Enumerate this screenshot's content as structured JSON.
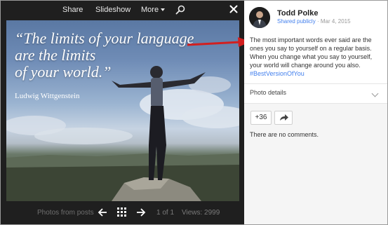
{
  "toolbar": {
    "share_label": "Share",
    "slideshow_label": "Slideshow",
    "more_label": "More",
    "icons": [
      "search-icon",
      "close-icon"
    ]
  },
  "photo": {
    "quote": "“The limits of your language\nare the limits\nof your world.”",
    "author": "Ludwig Wittgenstein"
  },
  "bottom_bar": {
    "label": "Photos from posts",
    "page": "1 of 1",
    "views": "Views: 2999",
    "icons": [
      "arrow-left-icon",
      "grid-icon",
      "arrow-right-icon"
    ]
  },
  "post": {
    "author": "Todd Polke",
    "visibility": "Shared publicly",
    "separator": "·",
    "date": "Mar 4, 2015",
    "text": "The most important words ever said are the ones you say to yourself on a regular basis. When you change what you say to yourself, your world will change around you also. ",
    "hashtag": "#BestVersionOfYou"
  },
  "details": {
    "label": "Photo details"
  },
  "actions": {
    "plus_label": "+36",
    "comments_text": "There are no comments."
  },
  "colors": {
    "viewer_bg": "#1f1f1f",
    "link": "#427fed",
    "annotation_arrow": "#d21f1f"
  }
}
